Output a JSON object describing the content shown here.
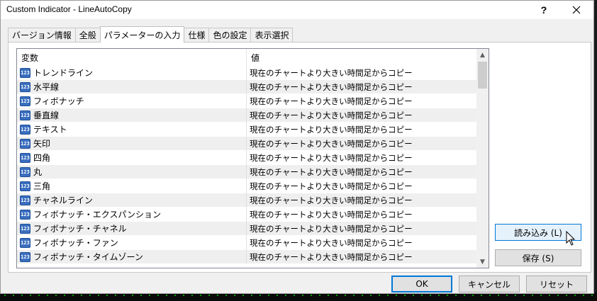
{
  "window": {
    "title": "Custom Indicator - LineAutoCopy",
    "help_label": "?",
    "close_icon": "close-icon"
  },
  "tabs": [
    {
      "label": "バージョン情報"
    },
    {
      "label": "全般"
    },
    {
      "label": "パラメーターの入力",
      "active": true
    },
    {
      "label": "仕様"
    },
    {
      "label": "色の設定"
    },
    {
      "label": "表示選択"
    }
  ],
  "table": {
    "columns": [
      "変数",
      "値"
    ],
    "type_icon_text": "123",
    "rows": [
      {
        "name": "トレンドライン",
        "value": "現在のチャートより大きい時間足からコピー"
      },
      {
        "name": "水平線",
        "value": "現在のチャートより大きい時間足からコピー"
      },
      {
        "name": "フィボナッチ",
        "value": "現在のチャートより大きい時間足からコピー"
      },
      {
        "name": "垂直線",
        "value": "現在のチャートより大きい時間足からコピー"
      },
      {
        "name": "テキスト",
        "value": "現在のチャートより大きい時間足からコピー"
      },
      {
        "name": "矢印",
        "value": "現在のチャートより大きい時間足からコピー"
      },
      {
        "name": "四角",
        "value": "現在のチャートより大きい時間足からコピー"
      },
      {
        "name": "丸",
        "value": "現在のチャートより大きい時間足からコピー"
      },
      {
        "name": "三角",
        "value": "現在のチャートより大きい時間足からコピー"
      },
      {
        "name": "チャネルライン",
        "value": "現在のチャートより大きい時間足からコピー"
      },
      {
        "name": "フィボナッチ・エクスパンション",
        "value": "現在のチャートより大きい時間足からコピー"
      },
      {
        "name": "フィボナッチ・チャネル",
        "value": "現在のチャートより大きい時間足からコピー"
      },
      {
        "name": "フィボナッチ・ファン",
        "value": "現在のチャートより大きい時間足からコピー"
      },
      {
        "name": "フィボナッチ・タイムゾーン",
        "value": "現在のチャートより大きい時間足からコピー"
      }
    ]
  },
  "buttons": {
    "load": "読み込み (L)",
    "save": "保存 (S)",
    "ok": "OK",
    "cancel": "キャンセル",
    "reset": "リセット"
  },
  "colors": {
    "accent": "#0078d7",
    "row_alt": "#efefef",
    "icon_blue": "#3a6fbf"
  }
}
